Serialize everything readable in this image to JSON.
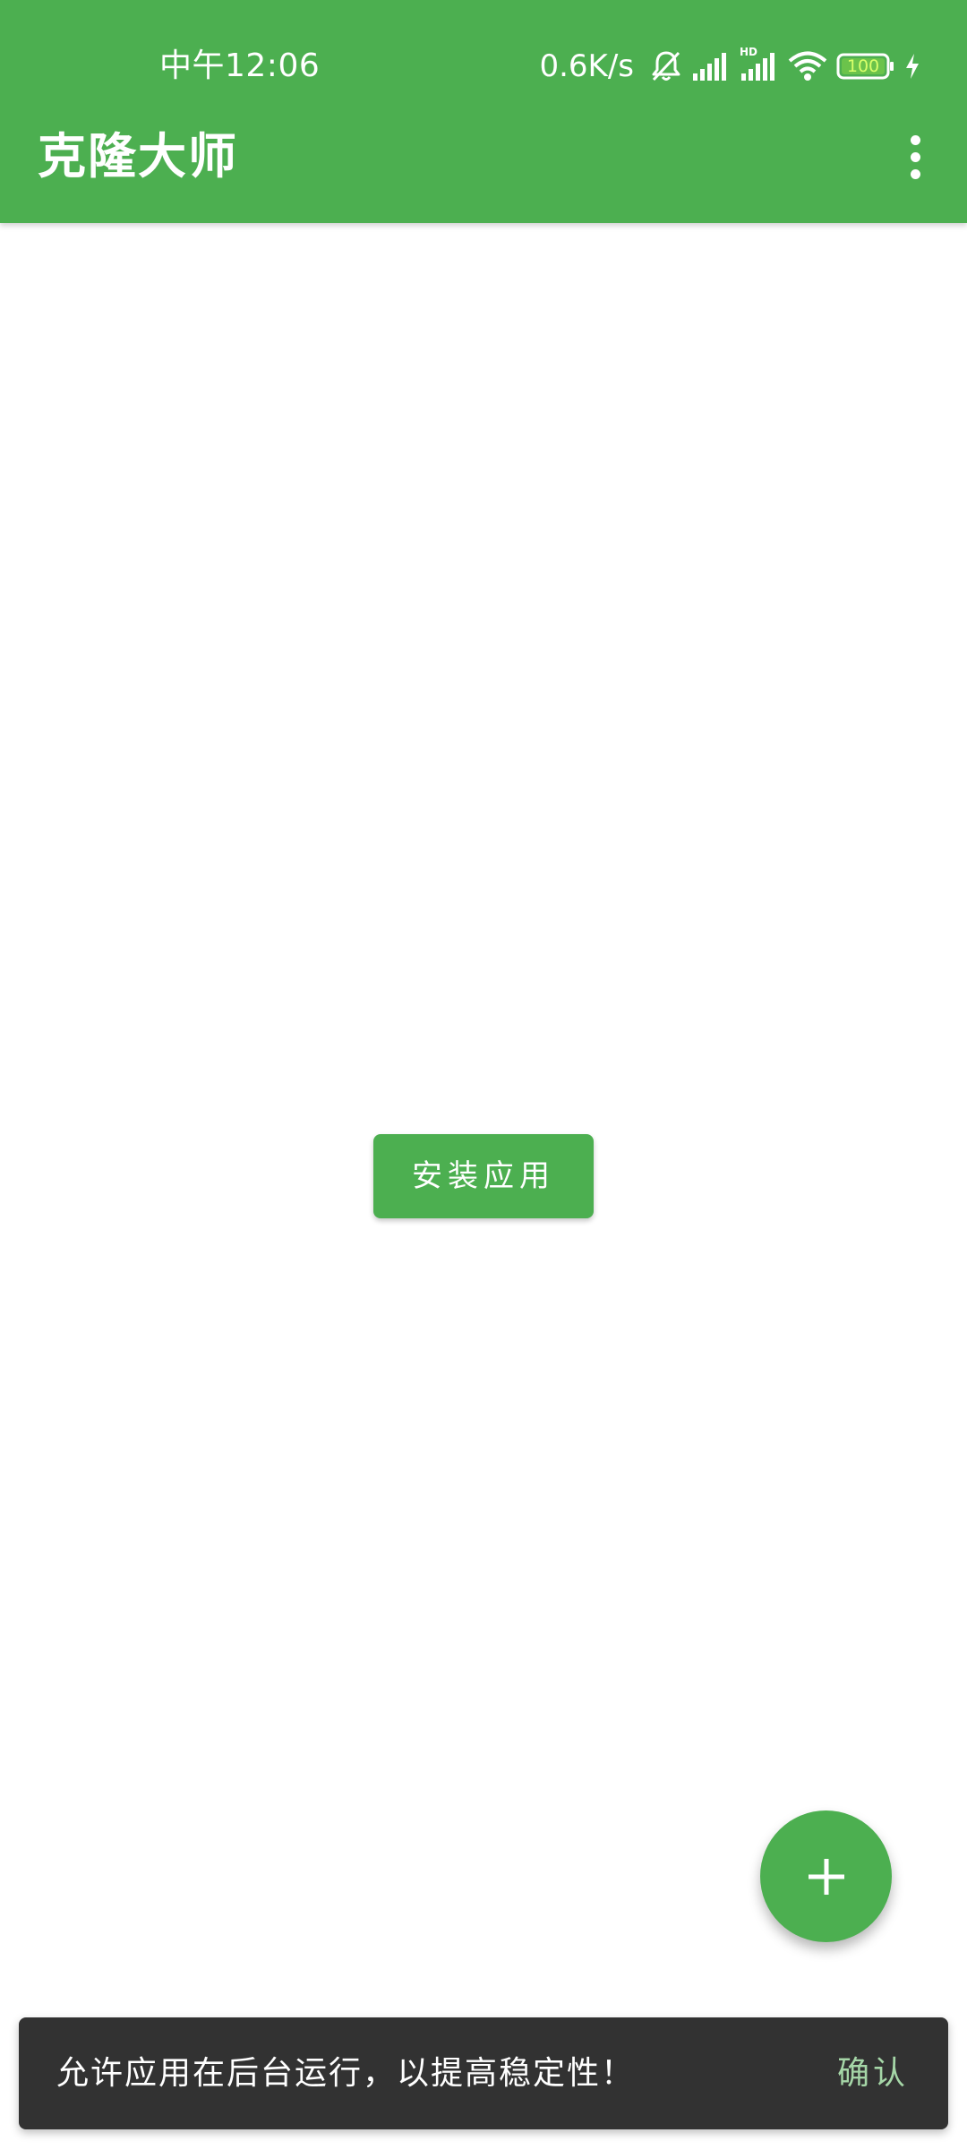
{
  "status_bar": {
    "time": "中午12:06",
    "net_speed": "0.6K/s",
    "hd_label": "HD",
    "battery_level": "100",
    "icons": [
      "bell-off-icon",
      "signal-icon",
      "signal-hd-icon",
      "wifi-icon",
      "battery-icon",
      "charging-icon"
    ]
  },
  "toolbar": {
    "title": "克隆大师",
    "menu_icon": "more-vert-icon"
  },
  "main": {
    "install_button_label": "安装应用"
  },
  "fab": {
    "icon": "plus-icon"
  },
  "snackbar": {
    "message": "允许应用在后台运行，以提高稳定性！",
    "action_label": "确认"
  },
  "colors": {
    "primary": "#4caf50",
    "snackbar_bg": "#323232",
    "snackbar_action": "#a5d6a7",
    "battery_fill": "#c6ff3a"
  }
}
